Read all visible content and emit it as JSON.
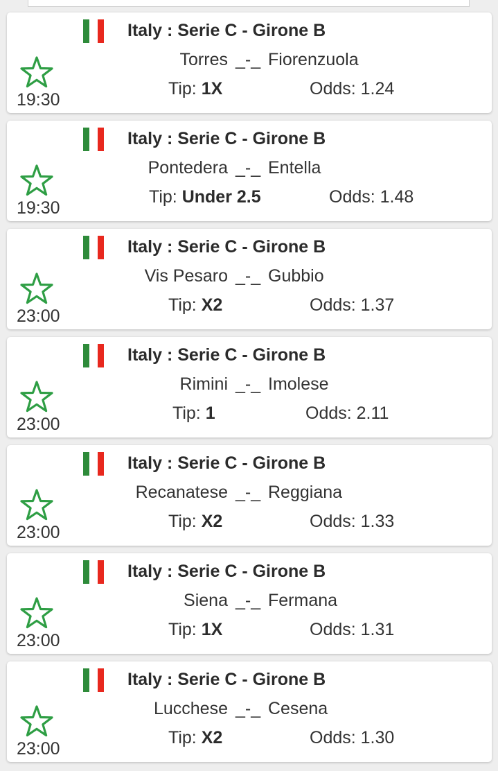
{
  "colors": {
    "accent_green": "#2e9e44",
    "flag_green": "#2e8b3a",
    "flag_red": "#e8281e",
    "card_bg": "#ffffff",
    "page_bg": "#eeeeee"
  },
  "tip_label": "Tip:",
  "odds_label": "Odds:",
  "score_separator": "_-_",
  "icons": {
    "favorite": "star-outline-icon",
    "flag": "italy-flag-icon"
  },
  "matches": [
    {
      "league": "Italy : Serie C - Girone B",
      "home": "Torres",
      "away": "Fiorenzuola",
      "tip": "1X",
      "odds": "1.24",
      "time": "19:30"
    },
    {
      "league": "Italy : Serie C - Girone B",
      "home": "Pontedera",
      "away": "Entella",
      "tip": "Under 2.5",
      "odds": "1.48",
      "time": "19:30"
    },
    {
      "league": "Italy : Serie C - Girone B",
      "home": "Vis Pesaro",
      "away": "Gubbio",
      "tip": "X2",
      "odds": "1.37",
      "time": "23:00"
    },
    {
      "league": "Italy : Serie C - Girone B",
      "home": "Rimini",
      "away": "Imolese",
      "tip": "1",
      "odds": "2.11",
      "time": "23:00"
    },
    {
      "league": "Italy : Serie C - Girone B",
      "home": "Recanatese",
      "away": "Reggiana",
      "tip": "X2",
      "odds": "1.33",
      "time": "23:00"
    },
    {
      "league": "Italy : Serie C - Girone B",
      "home": "Siena",
      "away": "Fermana",
      "tip": "1X",
      "odds": "1.31",
      "time": "23:00"
    },
    {
      "league": "Italy : Serie C - Girone B",
      "home": "Lucchese",
      "away": "Cesena",
      "tip": "X2",
      "odds": "1.30",
      "time": "23:00"
    }
  ]
}
